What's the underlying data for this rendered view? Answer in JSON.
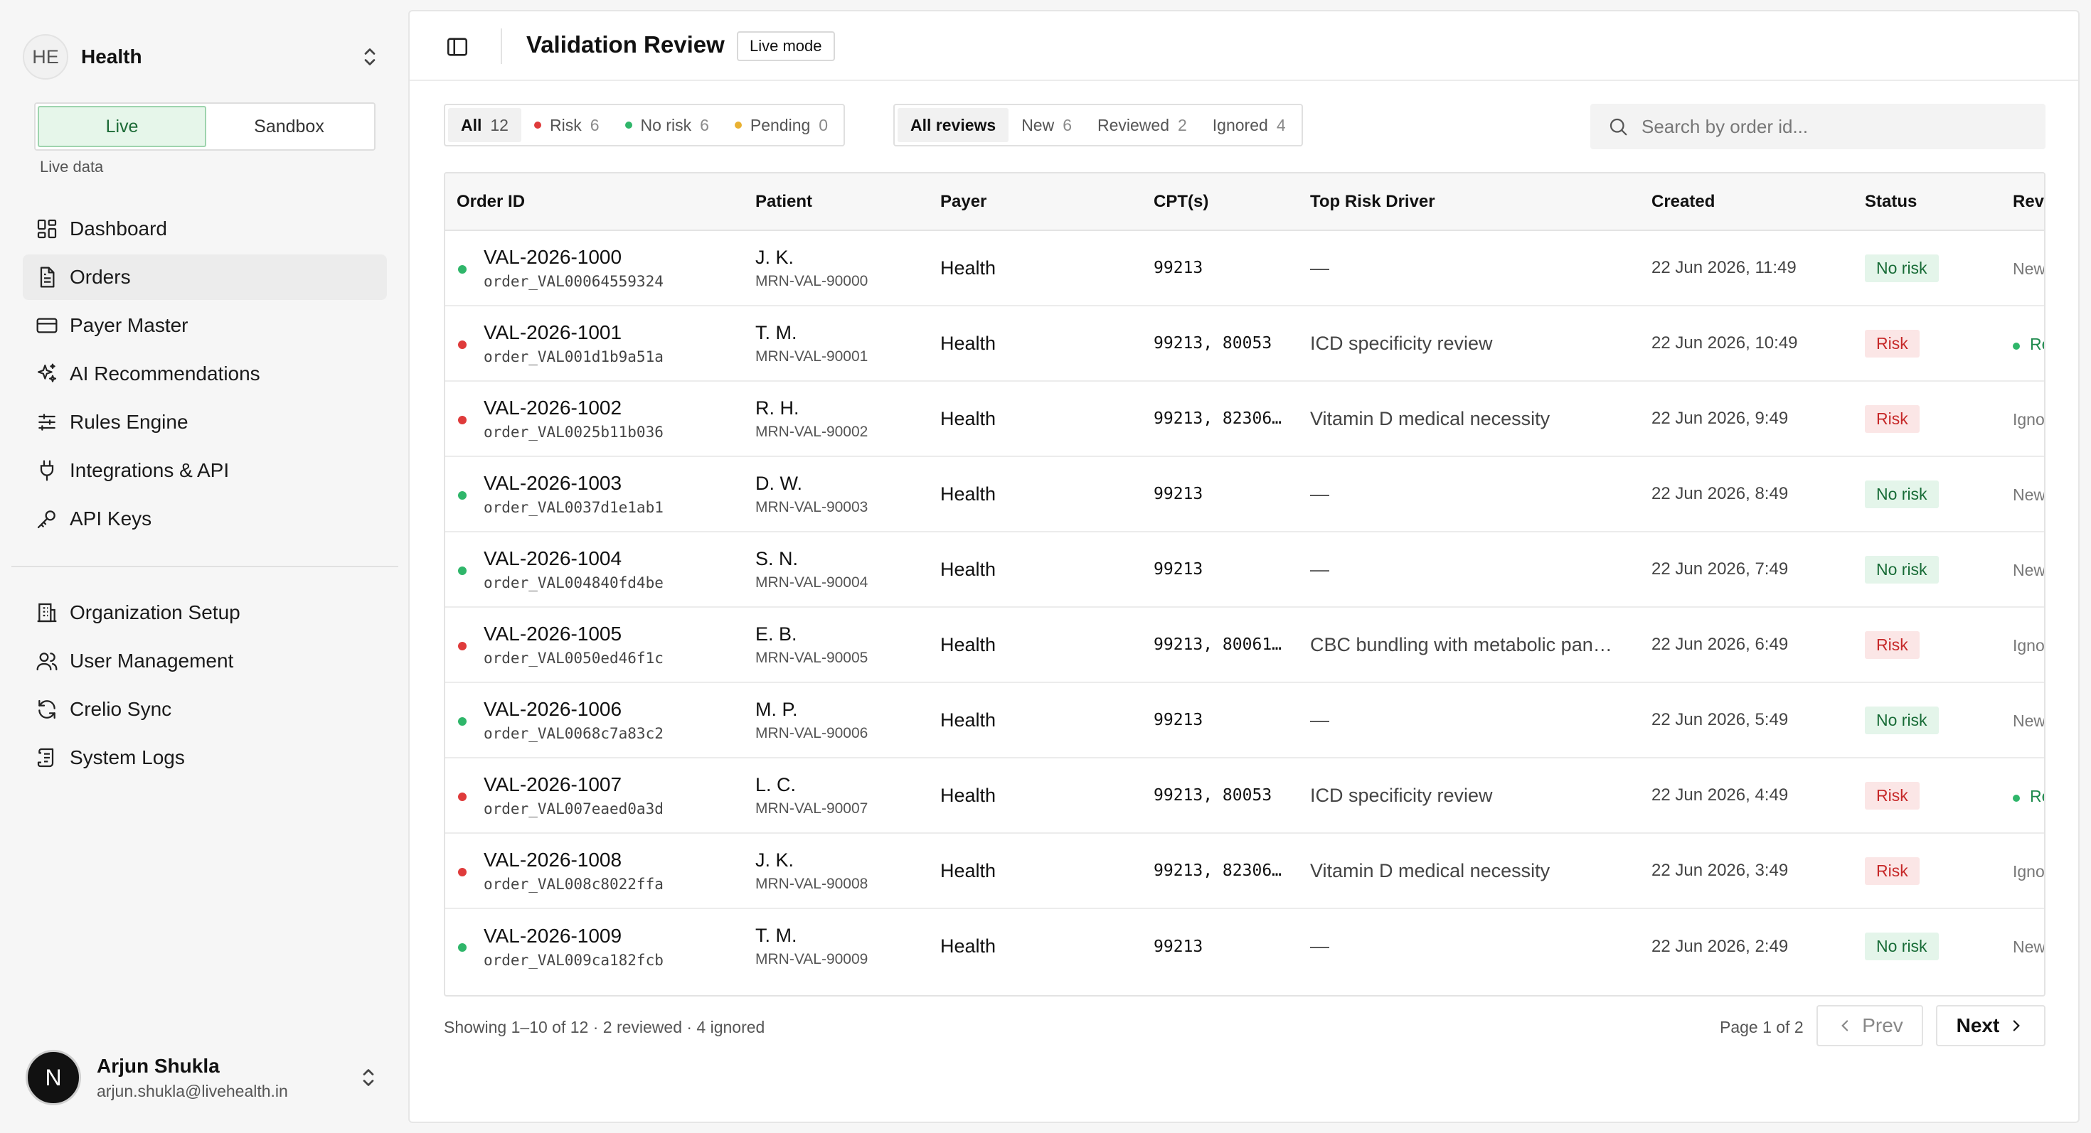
{
  "org": {
    "initials": "HE",
    "name": "Health"
  },
  "env": {
    "live": "Live",
    "sandbox": "Sandbox",
    "caption": "Live data"
  },
  "nav": {
    "main": [
      {
        "label": "Dashboard",
        "icon": "dashboard-icon"
      },
      {
        "label": "Orders",
        "icon": "document-icon",
        "active": true
      },
      {
        "label": "Payer Master",
        "icon": "card-icon"
      },
      {
        "label": "AI Recommendations",
        "icon": "sparkles-icon"
      },
      {
        "label": "Rules Engine",
        "icon": "sliders-icon"
      },
      {
        "label": "Integrations & API",
        "icon": "plug-icon"
      },
      {
        "label": "API Keys",
        "icon": "key-icon"
      }
    ],
    "admin": [
      {
        "label": "Organization Setup",
        "icon": "building-icon"
      },
      {
        "label": "User Management",
        "icon": "users-icon"
      },
      {
        "label": "Crelio Sync",
        "icon": "sync-icon"
      },
      {
        "label": "System Logs",
        "icon": "logs-icon"
      }
    ]
  },
  "user": {
    "initial": "N",
    "name": "Arjun Shukla",
    "email": "arjun.shukla@livehealth.in"
  },
  "header": {
    "title": "Validation Review",
    "mode": "Live mode"
  },
  "filters": {
    "status": [
      {
        "label": "All",
        "count": "12",
        "active": true
      },
      {
        "label": "Risk",
        "count": "6",
        "dot": "red"
      },
      {
        "label": "No risk",
        "count": "6",
        "dot": "green"
      },
      {
        "label": "Pending",
        "count": "0",
        "dot": "amber"
      }
    ],
    "review": [
      {
        "label": "All reviews",
        "count": "",
        "active": true
      },
      {
        "label": "New",
        "count": "6"
      },
      {
        "label": "Reviewed",
        "count": "2"
      },
      {
        "label": "Ignored",
        "count": "4"
      }
    ]
  },
  "search": {
    "placeholder": "Search by order id..."
  },
  "table": {
    "columns": [
      "Order ID",
      "Patient",
      "Payer",
      "CPT(s)",
      "Top Risk Driver",
      "Created",
      "Status",
      "Reviewed"
    ],
    "rows": [
      {
        "order_id": "VAL-2026-1000",
        "order_key": "order_VAL00064559324",
        "patient": "J. K.",
        "mrn": "MRN-VAL-90000",
        "payer": "Health",
        "cpt": "99213",
        "driver": "—",
        "created": "22 Jun 2026, 11:49",
        "status": "No risk",
        "risk": false,
        "review": "New",
        "review_state": "new"
      },
      {
        "order_id": "VAL-2026-1001",
        "order_key": "order_VAL001d1b9a51a",
        "patient": "T. M.",
        "mrn": "MRN-VAL-90001",
        "payer": "Health",
        "cpt": "99213, 80053",
        "driver": "ICD specificity review",
        "created": "22 Jun 2026, 10:49",
        "status": "Risk",
        "risk": true,
        "review": "Reviewed",
        "review_state": "reviewed"
      },
      {
        "order_id": "VAL-2026-1002",
        "order_key": "order_VAL0025b11b036",
        "patient": "R. H.",
        "mrn": "MRN-VAL-90002",
        "payer": "Health",
        "cpt": "99213, 82306…",
        "driver": "Vitamin D medical necessity",
        "created": "22 Jun 2026, 9:49",
        "status": "Risk",
        "risk": true,
        "review": "Ignored",
        "review_state": "ignored"
      },
      {
        "order_id": "VAL-2026-1003",
        "order_key": "order_VAL0037d1e1ab1",
        "patient": "D. W.",
        "mrn": "MRN-VAL-90003",
        "payer": "Health",
        "cpt": "99213",
        "driver": "—",
        "created": "22 Jun 2026, 8:49",
        "status": "No risk",
        "risk": false,
        "review": "New",
        "review_state": "new"
      },
      {
        "order_id": "VAL-2026-1004",
        "order_key": "order_VAL004840fd4be",
        "patient": "S. N.",
        "mrn": "MRN-VAL-90004",
        "payer": "Health",
        "cpt": "99213",
        "driver": "—",
        "created": "22 Jun 2026, 7:49",
        "status": "No risk",
        "risk": false,
        "review": "New",
        "review_state": "new"
      },
      {
        "order_id": "VAL-2026-1005",
        "order_key": "order_VAL0050ed46f1c",
        "patient": "E. B.",
        "mrn": "MRN-VAL-90005",
        "payer": "Health",
        "cpt": "99213, 80061…",
        "driver": "CBC bundling with metabolic pan…",
        "created": "22 Jun 2026, 6:49",
        "status": "Risk",
        "risk": true,
        "review": "Ignored",
        "review_state": "ignored"
      },
      {
        "order_id": "VAL-2026-1006",
        "order_key": "order_VAL0068c7a83c2",
        "patient": "M. P.",
        "mrn": "MRN-VAL-90006",
        "payer": "Health",
        "cpt": "99213",
        "driver": "—",
        "created": "22 Jun 2026, 5:49",
        "status": "No risk",
        "risk": false,
        "review": "New",
        "review_state": "new"
      },
      {
        "order_id": "VAL-2026-1007",
        "order_key": "order_VAL007eaed0a3d",
        "patient": "L. C.",
        "mrn": "MRN-VAL-90007",
        "payer": "Health",
        "cpt": "99213, 80053",
        "driver": "ICD specificity review",
        "created": "22 Jun 2026, 4:49",
        "status": "Risk",
        "risk": true,
        "review": "Reviewed",
        "review_state": "reviewed"
      },
      {
        "order_id": "VAL-2026-1008",
        "order_key": "order_VAL008c8022ffa",
        "patient": "J. K.",
        "mrn": "MRN-VAL-90008",
        "payer": "Health",
        "cpt": "99213, 82306…",
        "driver": "Vitamin D medical necessity",
        "created": "22 Jun 2026, 3:49",
        "status": "Risk",
        "risk": true,
        "review": "Ignored",
        "review_state": "ignored"
      },
      {
        "order_id": "VAL-2026-1009",
        "order_key": "order_VAL009ca182fcb",
        "patient": "T. M.",
        "mrn": "MRN-VAL-90009",
        "payer": "Health",
        "cpt": "99213",
        "driver": "—",
        "created": "22 Jun 2026, 2:49",
        "status": "No risk",
        "risk": false,
        "review": "New",
        "review_state": "new"
      }
    ]
  },
  "footer": {
    "summary": "Showing 1–10 of 12 · 2 reviewed · 4 ignored",
    "page": "Page 1 of 2",
    "prev": "Prev",
    "next": "Next"
  },
  "colors": {
    "risk": "#df3b3b",
    "no_risk": "#2fb66a",
    "pending": "#e9b132",
    "live_bg": "#e6f6ea"
  }
}
